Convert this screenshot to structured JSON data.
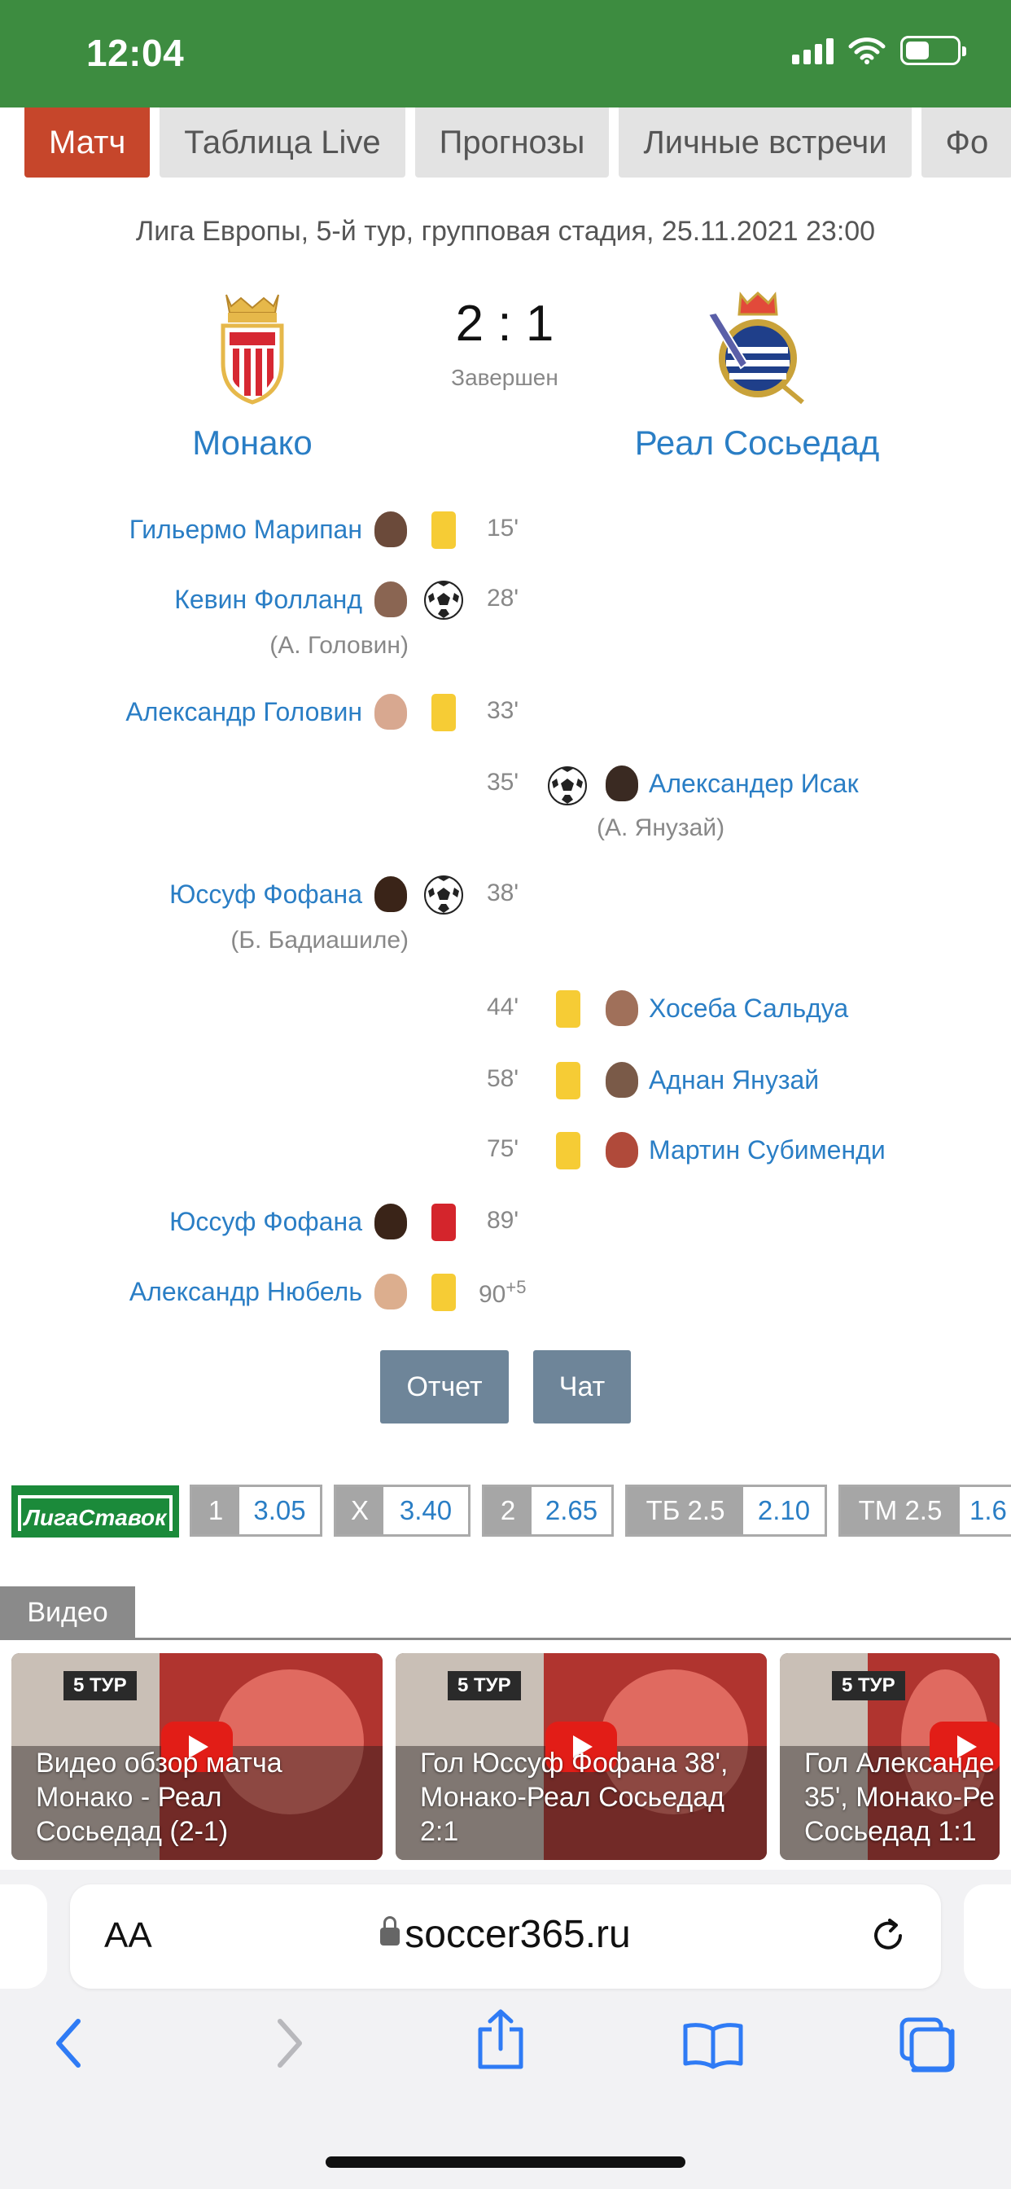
{
  "status_bar": {
    "time": "12:04"
  },
  "tabs": [
    {
      "label": "Матч",
      "active": true
    },
    {
      "label": "Таблица Live"
    },
    {
      "label": "Прогнозы"
    },
    {
      "label": "Личные встречи"
    },
    {
      "label": "Фо"
    }
  ],
  "match": {
    "info": "Лига Европы, 5-й тур, групповая стадия, 25.11.2021 23:00",
    "score": "2 : 1",
    "status": "Завершен",
    "home": {
      "name": "Монако",
      "logo": "monaco-crest-icon"
    },
    "away": {
      "name": "Реал Сосьедад",
      "logo": "real-sociedad-crest-icon"
    }
  },
  "events": [
    {
      "side": "home",
      "player": "Гильермо Марипан",
      "type": "yellow",
      "minute": "15'"
    },
    {
      "side": "home",
      "player": "Кевин Фолланд",
      "type": "goal",
      "minute": "28'",
      "assist": "(А. Головин)"
    },
    {
      "side": "home",
      "player": "Александр Головин",
      "type": "yellow",
      "minute": "33'"
    },
    {
      "side": "away",
      "player": "Александер Исак",
      "type": "goal",
      "minute": "35'",
      "assist": "(А. Янузай)"
    },
    {
      "side": "home",
      "player": "Юссуф Фофана",
      "type": "goal",
      "minute": "38'",
      "assist": "(Б. Бадиашиле)"
    },
    {
      "side": "away",
      "player": "Хосеба Сальдуа",
      "type": "yellow",
      "minute": "44'"
    },
    {
      "side": "away",
      "player": "Аднан Янузай",
      "type": "yellow",
      "minute": "58'"
    },
    {
      "side": "away",
      "player": "Мартин Субименди",
      "type": "yellow",
      "minute": "75'"
    },
    {
      "side": "home",
      "player": "Юссуф Фофана",
      "type": "red",
      "minute": "89'"
    },
    {
      "side": "home",
      "player": "Александр Нюбель",
      "type": "yellow",
      "minute": "90",
      "minute_extra": "+5"
    }
  ],
  "buttons": {
    "report": "Отчет",
    "chat": "Чат"
  },
  "odds": {
    "bookmaker": "ЛигаСтавок",
    "items": [
      {
        "label": "1",
        "value": "3.05"
      },
      {
        "label": "X",
        "value": "3.40"
      },
      {
        "label": "2",
        "value": "2.65"
      },
      {
        "label": "ТБ 2.5",
        "value": "2.10"
      },
      {
        "label": "ТМ 2.5",
        "value": "1.6"
      }
    ]
  },
  "video": {
    "header": "Видео",
    "cards": [
      {
        "tag": "5 ТУР",
        "title": "Видео обзор матча Монако - Реал Сосьедад (2-1)"
      },
      {
        "tag": "5 ТУР",
        "title": "Гол Юссуф Фофана 38', Монако-Реал Сосьедад 2:1"
      },
      {
        "tag": "5 ТУР",
        "title": "Гол Александе 35', Монако-Ре Сосьедад 1:1"
      }
    ]
  },
  "browser": {
    "aa_label": "AA",
    "url": "soccer365.ru"
  },
  "colors": {
    "status_bar": "#3d8c40",
    "active_tab": "#c6462b",
    "link": "#2a7ec5",
    "yellow_card": "#f6cc35",
    "red_card": "#d4252c",
    "button": "#6e8599"
  }
}
